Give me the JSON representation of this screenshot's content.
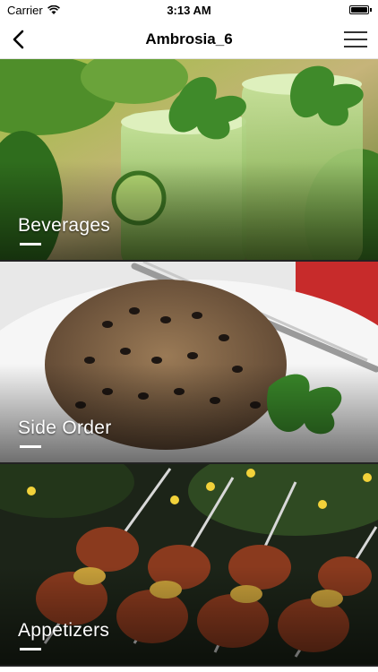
{
  "status_bar": {
    "carrier": "Carrier",
    "time": "3:13 AM",
    "battery_level": 1.0
  },
  "nav": {
    "title": "Ambrosia_6",
    "back_icon": "chevron-left-icon",
    "menu_icon": "hamburger-menu-icon"
  },
  "categories": [
    {
      "label": "Beverages"
    },
    {
      "label": "Side Order"
    },
    {
      "label": "Appetizers"
    }
  ],
  "colors": {
    "nav_background": "#ffffff",
    "tile_text": "#ffffff"
  }
}
